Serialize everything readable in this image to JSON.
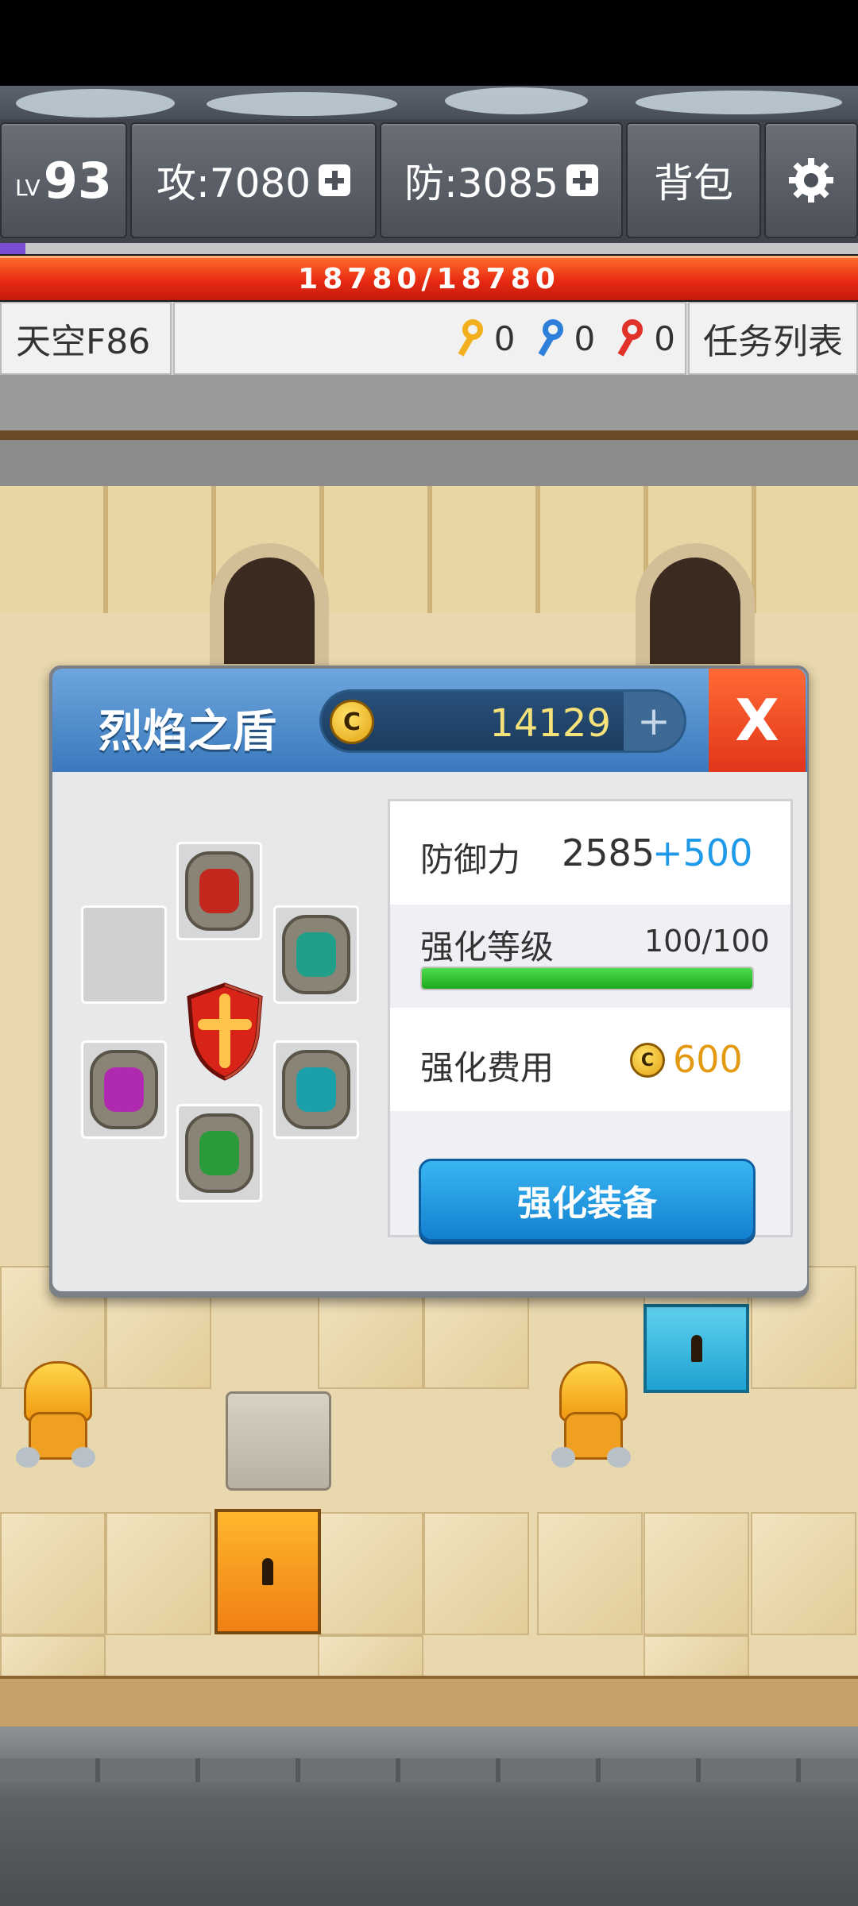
{
  "hud": {
    "level_prefix": "LV",
    "level": "93",
    "attack": "攻:7080",
    "defense": "防:3085",
    "bag": "背包",
    "hp": "18780/18780"
  },
  "info": {
    "floor": "天空F86",
    "keys": [
      {
        "color": "#f2b01e",
        "count": "0"
      },
      {
        "color": "#2d7fd9",
        "count": "0"
      },
      {
        "color": "#e1322a",
        "count": "0"
      }
    ],
    "quest_list": "任务列表"
  },
  "modal": {
    "title": "烈焰之盾",
    "gold": "14129",
    "gold_icon": "C",
    "close": "X",
    "defense_label": "防御力",
    "defense_base": "2585",
    "defense_bonus": "+500",
    "level_label": "强化等级",
    "level_value": "100/100",
    "level_progress": 1.0,
    "cost_label": "强化费用",
    "cost_value": "600",
    "enhance_button": "强化装备",
    "gems": [
      {
        "slot": "top",
        "color": "#c2281e"
      },
      {
        "slot": "right-upper",
        "color": "#20a08a"
      },
      {
        "slot": "left-lower",
        "color": "#b02ab0"
      },
      {
        "slot": "right-lower",
        "color": "#1aa0a8"
      },
      {
        "slot": "bottom",
        "color": "#2a9a3a"
      }
    ]
  }
}
